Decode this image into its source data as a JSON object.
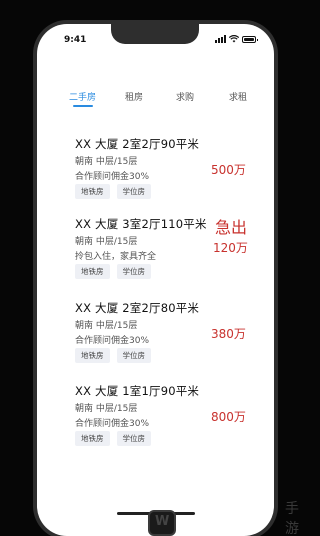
{
  "status_bar": {
    "time": "9:41"
  },
  "tabs": [
    {
      "label": "二手房",
      "active": true
    },
    {
      "label": "租房",
      "active": false
    },
    {
      "label": "求购",
      "active": false
    },
    {
      "label": "求租",
      "active": false
    }
  ],
  "listings": [
    {
      "title": "XX  大厦  2室2厅90平米",
      "orientation_floor": "朝南 中层/15层",
      "note": "合作顾问佣金30%",
      "tags": [
        "地铁房",
        "学位房"
      ],
      "price": "500万",
      "urgent": ""
    },
    {
      "title": "XX  大厦  3室2厅110平米",
      "orientation_floor": "朝南 中层/15层",
      "note": "拎包入住，家具齐全",
      "tags": [
        "地铁房",
        "学位房"
      ],
      "price": "120万",
      "urgent": "急出"
    },
    {
      "title": "XX  大厦  2室2厅80平米",
      "orientation_floor": "朝南 中层/15层",
      "note": "合作顾问佣金30%",
      "tags": [
        "地铁房",
        "学位房"
      ],
      "price": "380万",
      "urgent": ""
    },
    {
      "title": "XX  大厦 1室1厅90平米",
      "orientation_floor": "朝南 中层/15层",
      "note": "合作顾问佣金30%",
      "tags": [
        "地铁房",
        "学位房"
      ],
      "price": "800万",
      "urgent": ""
    }
  ],
  "colors": {
    "accent": "#2a8be0",
    "price": "#c8322e",
    "tag_bg": "#eef0f5"
  },
  "watermark": {
    "text": "手游"
  }
}
